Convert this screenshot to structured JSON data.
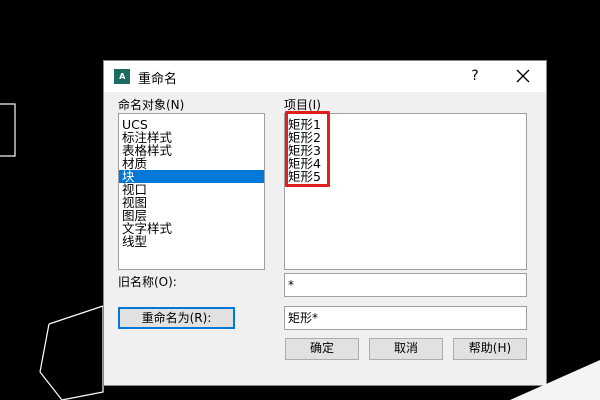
{
  "dialog": {
    "app_icon_text": "A",
    "title": "重命名",
    "help_symbol": "?",
    "named_objects_label": "命名对象(N)",
    "named_objects": [
      "UCS",
      "标注样式",
      "表格样式",
      "材质",
      "块",
      "视口",
      "视图",
      "图层",
      "文字样式",
      "线型"
    ],
    "selected_object_index": 4,
    "items_label": "项目(I)",
    "items": [
      "矩形1",
      "矩形2",
      "矩形3",
      "矩形4",
      "矩形5"
    ],
    "old_name_label": "旧名称(O):",
    "old_name_value": "*",
    "rename_to_button": "重命名为(R):",
    "new_name_value": "矩形*",
    "ok_button": "确定",
    "cancel_button": "取消",
    "help_button": "帮助(H)"
  },
  "colors": {
    "canvas": "#000000",
    "selection": "#0078d7",
    "highlight": "#e01e1e"
  }
}
